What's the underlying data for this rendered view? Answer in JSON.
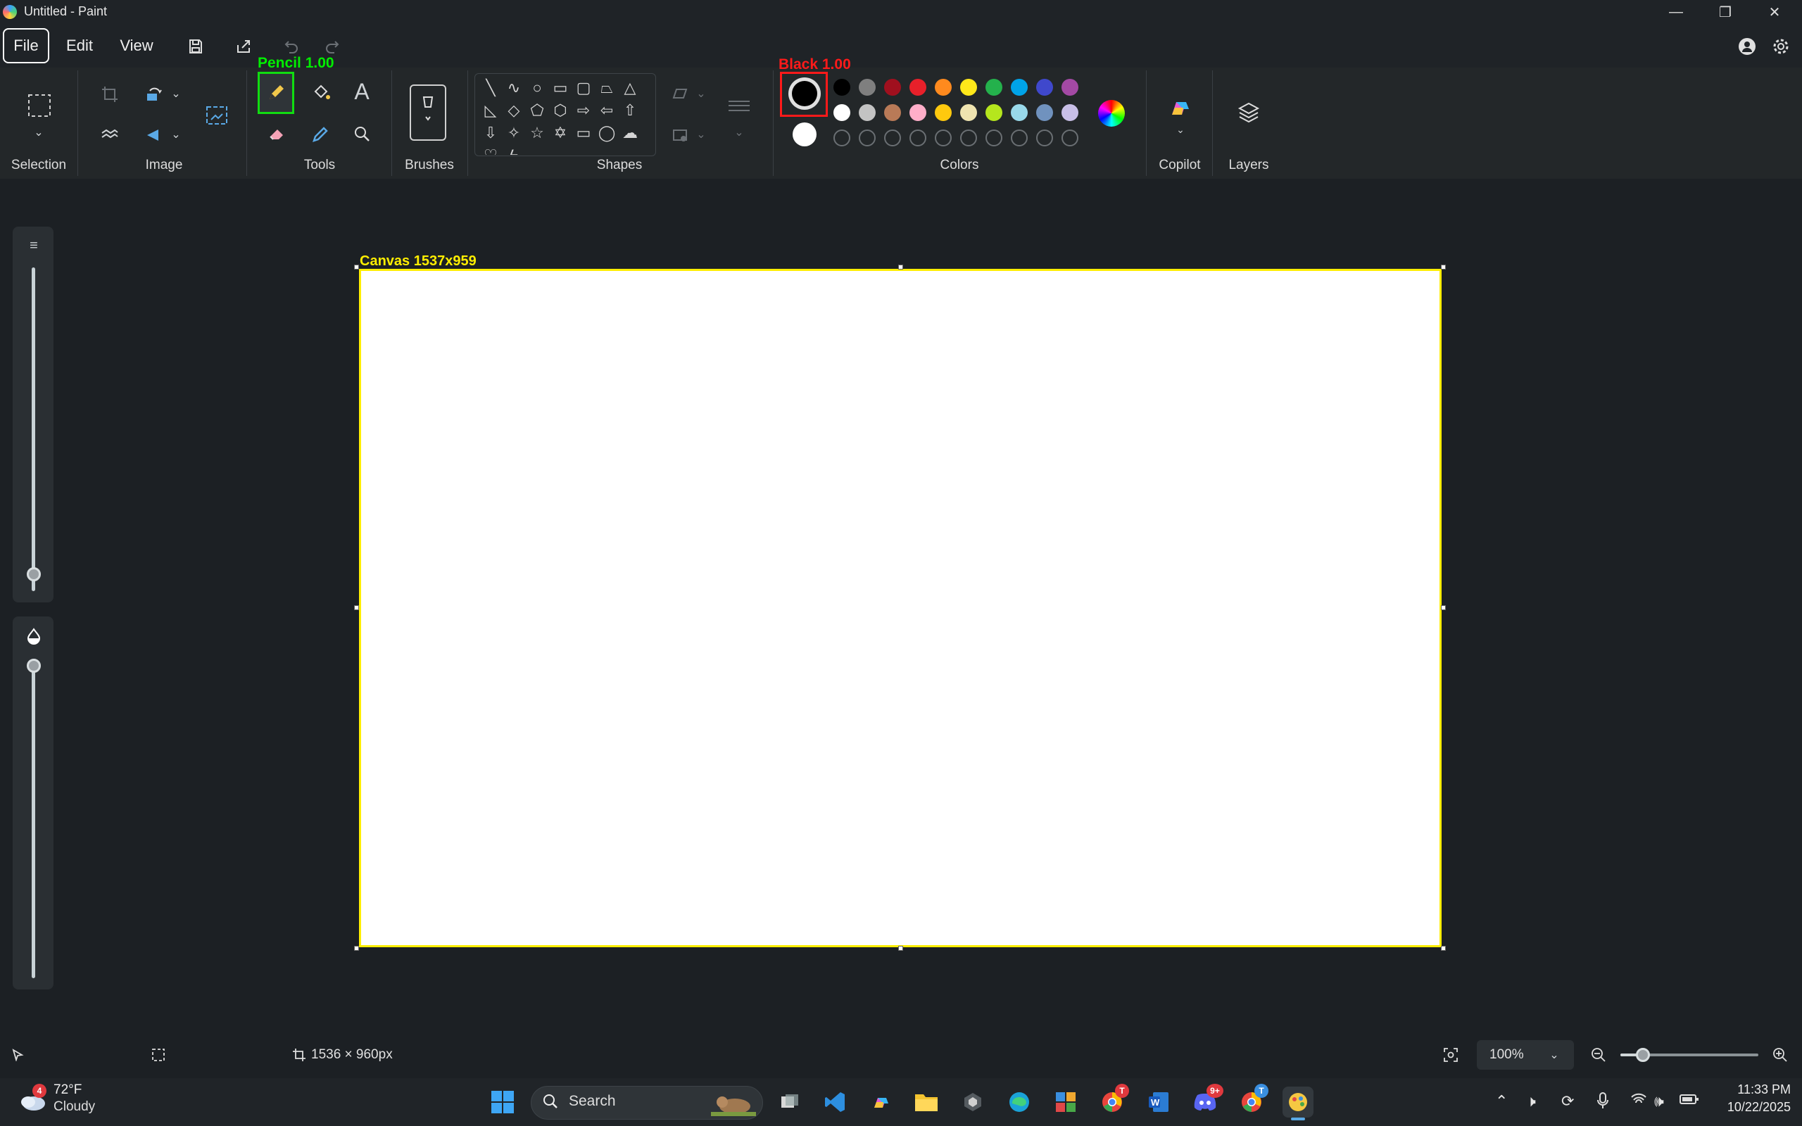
{
  "window": {
    "title": "Untitled - Paint",
    "controls": {
      "minimize": "—",
      "restore": "❐",
      "close": "✕"
    }
  },
  "menubar": {
    "file": "File",
    "edit": "Edit",
    "view": "View"
  },
  "ribbon": {
    "groups": {
      "selection": "Selection",
      "image": "Image",
      "tools": "Tools",
      "brushes": "Brushes",
      "shapes": "Shapes",
      "colors": "Colors",
      "copilot": "Copilot",
      "layers": "Layers"
    },
    "tool_annotation": "Pencil 1.00",
    "color_annotation": "Black 1.00",
    "shapes": [
      "line",
      "curve",
      "oval",
      "rectangle",
      "rounded-rectangle",
      "polygon",
      "triangle",
      "right-triangle",
      "diamond",
      "pentagon",
      "hexagon",
      "right-arrow",
      "left-arrow",
      "up-arrow",
      "down-arrow",
      "four-point-star",
      "five-point-star",
      "six-point-star",
      "rounded-callout",
      "oval-callout",
      "cloud-callout",
      "heart",
      "lightning"
    ],
    "colors": {
      "primary": "#000000",
      "secondary": "#ffffff",
      "row1": [
        "#000000",
        "#7f7f7f",
        "#a0101e",
        "#e8202a",
        "#ff8a1e",
        "#ffe81a",
        "#24b14c",
        "#00a3e8",
        "#3f48cc",
        "#a349a4"
      ],
      "row2": [
        "#ffffff",
        "#c3c3c3",
        "#b97a57",
        "#ffaec9",
        "#ffc90e",
        "#efe4b0",
        "#b5e61d",
        "#99d9ea",
        "#7092be",
        "#c8bfe7"
      ],
      "row3_count": 10
    }
  },
  "canvas": {
    "label": "Canvas 1537x959",
    "background": "#ffffff",
    "border_color": "#ffee00"
  },
  "statusbar": {
    "canvas_size": "1536 × 960px",
    "zoom": "100%",
    "zoom_level_fraction": 0.1
  },
  "taskbar": {
    "weather": {
      "temp": "72°F",
      "condition": "Cloudy",
      "badge": "4"
    },
    "search_placeholder": "Search",
    "discord_badge": "9+",
    "chrome_badge1": "T",
    "chrome_badge2": "T",
    "time": "11:33 PM",
    "date": "10/22/2025"
  },
  "sliders": {
    "size_level_fraction": 0.04,
    "opacity_level_fraction": 1.0
  }
}
